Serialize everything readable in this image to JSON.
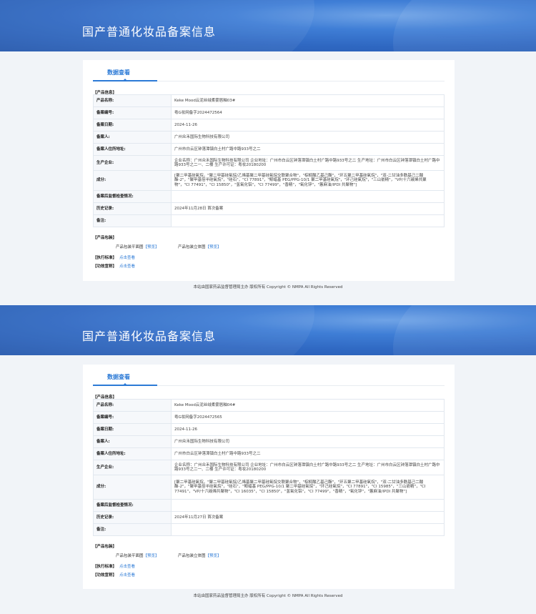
{
  "page_title": "国产普通化妆品备案信息",
  "tab_label": "数据查看",
  "labels": {
    "product_info": "【产品信息】",
    "product_name": "产品名称:",
    "record_no": "备案编号:",
    "record_date": "备案日期:",
    "registrant": "备案人:",
    "registrant_address": "备案人住所地址:",
    "manufacturer": "生产企业:",
    "ingredients": "成分:",
    "post_supervision": "备案后监督检查情况:",
    "history": "历史记录:",
    "notes": "备注:",
    "product_package": "【产品包装】",
    "package_flat": "产品包装平面图",
    "package_3d": "产品包装立体图",
    "preview": "【预览】",
    "standard": "【执行标准】",
    "efficacy": "【功效宣称】",
    "click_view": "点击查看"
  },
  "records": [
    {
      "product_name": "Keke Mood云泥丝绒柔雾唇釉03#",
      "record_no": "粤G妆网备字2024472564",
      "record_date": "2024-11-26",
      "registrant": "广州众禾国际生物科技有限公司",
      "registrant_address": "广州市白云区钟落潭镇白土村广路中路933号之二",
      "manufacturer": "企业名称：广州众禾国际生物科技有限公司 企业地址：广州市白云区钟落潭镇白土村广路中路933号之二 生产地址：广州市白云区钟落潭镇白土村广路中路933号之二一、二楼 生产许可证：粤妆20180200",
      "ingredients": "[聚二甲基硅氧烷，\"聚二甲基硅氧烷/乙烯基聚二甲基硅氧烷交联聚合物\"，\"棕榈酸乙基己酯\"，\"环五聚二甲基硅氧烷\"，\"双-二甘油多酰基己二酸酯-2\"，\"聚甲基倍半硅氧烷\"，\"硅石\"，\"CI 77891\"，\"鲸蜡基 PEG/PPG-10/1 聚二甲基硅氧烷\"，\"环己硅氧烷\"，\"三山嵛精\"，\"VP/十六碳烯共聚物\"，\"CI 77491\"，\"CI 15850\"，\"氢氧化铝\"，\"CI 77499\"，\"香精\"，\"氧化锌\"，\"蕙麻油/IPDI 共聚物\"]",
      "post_supervision": "",
      "history": "2024年11月28日 首次备案",
      "notes": ""
    },
    {
      "product_name": "Keke Mood云泥丝绒柔雾唇釉04#",
      "record_no": "粤G妆网备字2024472565",
      "record_date": "2024-11-26",
      "registrant": "广州众禾国际生物科技有限公司",
      "registrant_address": "广州市白云区钟落潭镇白土村广路中路933号之二",
      "manufacturer": "企业名称：广州众禾国际生物科技有限公司 企业地址：广州市白云区钟落潭镇白土村广路中路933号之二 生产地址：广州市白云区钟落潭镇白土村广路中路933号之二一、二楼 生产许可证：粤妆20180200",
      "ingredients": "[聚二甲基硅氧烷，\"聚二甲基硅氧烷/乙烯基聚二甲基硅氧烷交联聚合物\"，\"棕榈酸乙基己酯\"，\"环五聚二甲基硅氧烷\"，\"双-二甘油多酰基己二酸酯-2\"，\"聚甲基倍半硅氧烷\"，\"硅石\"，\"鲸蜡基 PEG/PPG-10/1 聚二甲基硅氧烷\"，\"环己硅氧烷\"，\"CI 77891\"，\"CI 15985\"，\"三山嵛精\"，\"CI 77491\"，\"VP/十六碳烯共聚物\"，\"CI 16035\"，\"CI 15850\"，\"氢氧化铝\"，\"CI 77499\"，\"香精\"，\"氧化锌\"，\"蕙麻油/IPDI 共聚物\"]",
      "post_supervision": "",
      "history": "2024年11月27日 首次备案",
      "notes": ""
    }
  ],
  "footer": "本站由国家药品监督管理局主办 版权所有 Copyright © NMPA All Rights Reserved"
}
